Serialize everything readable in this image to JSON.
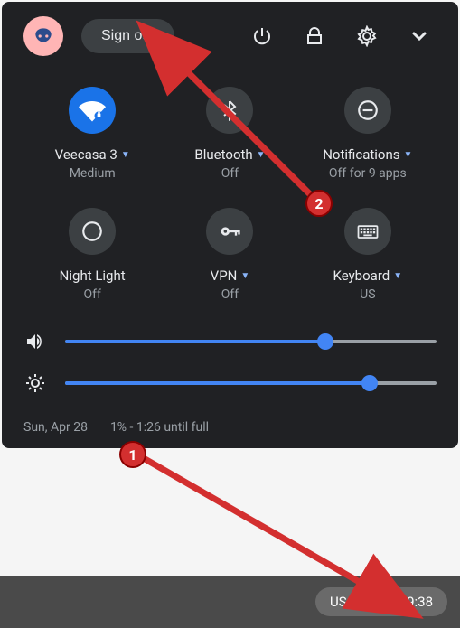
{
  "header": {
    "signout_label": "Sign out"
  },
  "tiles": {
    "wifi": {
      "label": "Veecasa 3",
      "sub": "Medium",
      "has_caret": true,
      "active": true
    },
    "bluetooth": {
      "label": "Bluetooth",
      "sub": "Off",
      "has_caret": true,
      "active": false
    },
    "notif": {
      "label": "Notifications",
      "sub": "Off for 9 apps",
      "has_caret": true,
      "active": false
    },
    "nightlight": {
      "label": "Night Light",
      "sub": "Off",
      "has_caret": false,
      "active": false
    },
    "vpn": {
      "label": "VPN",
      "sub": "Off",
      "has_caret": true,
      "active": false
    },
    "keyboard": {
      "label": "Keyboard",
      "sub": "US",
      "has_caret": true,
      "active": false
    }
  },
  "sliders": {
    "volume_pct": 70,
    "brightness_pct": 82
  },
  "footer": {
    "date": "Sun, Apr 28",
    "battery": "1% - 1:26 until full"
  },
  "tray": {
    "ime": "US",
    "time": "09:38"
  },
  "annotations": {
    "badge1": "1",
    "badge2": "2"
  }
}
